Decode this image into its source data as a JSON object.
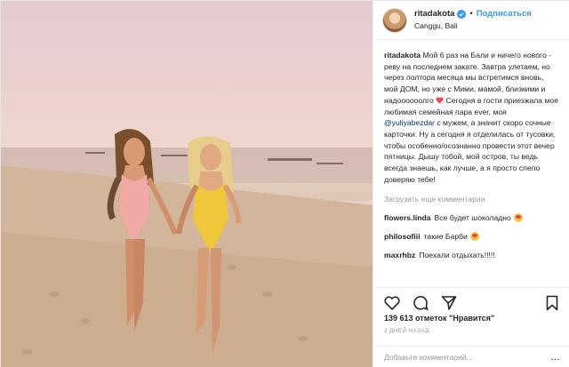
{
  "header": {
    "username": "ritadakota",
    "follow_label": "Подписаться",
    "location": "Canggu, Bali",
    "dot": "•"
  },
  "caption": {
    "username": "ritadakota",
    "text_1": " Мой 6 раз на Бали и ничего нового - реву на последнем закате. Завтра улетаем, но через полтора месяца мы встретимся вновь, мой ДОМ, но уже с Мими, мамой, близкими и надоооооолго ",
    "text_2": " Сегодня в гости приезжала моя любимая семейная пара ever, моя ",
    "mention": "@yuliyabezdar",
    "text_3": " с мужем, а значит скоро сочные карточки. Ну а сегодня я отделилась от тусовки, чтобы особенно/осознанно провести этот вечер пятницы. Дышу тобой, мой остров, ты ведь всегда знаешь, как лучше, а я просто слепо доверяю тебе!"
  },
  "load_more_label": "Загрузить еще комментарии",
  "comments": [
    {
      "username": "flowers.linda",
      "text": "Все будет шоколадно",
      "emoji": "smiling-face-emoji"
    },
    {
      "username": "philosofiii",
      "text": "такие Барби",
      "emoji": "smiling-face-emoji"
    },
    {
      "username": "maxrhbz",
      "text": "Поехали отдыхать!!!!!",
      "emoji": ""
    }
  ],
  "likes_text": "139 613 отметок \"Нравится\"",
  "date_text": "2 ДНЕЙ НАЗАД",
  "add_comment_placeholder": "Добавьте комментарий...",
  "more_label": "...",
  "colors": {
    "link": "#3897f0",
    "verified": "#3897f0",
    "heart": "#ed4956",
    "muted": "#999999"
  },
  "icons": [
    "verified-badge-icon",
    "heart-emoji",
    "like-icon",
    "comment-icon",
    "share-icon",
    "save-icon"
  ]
}
